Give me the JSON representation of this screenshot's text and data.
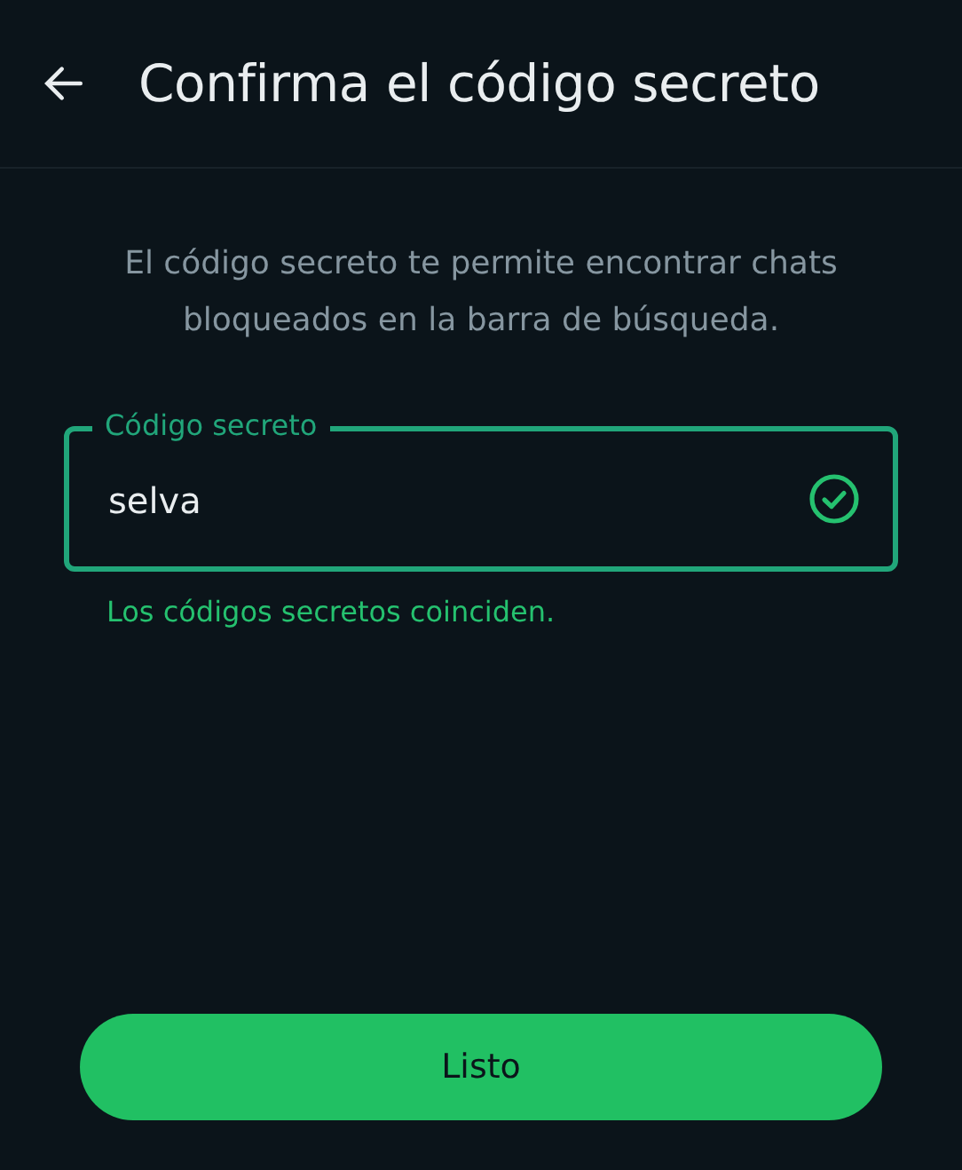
{
  "header": {
    "title": "Confirma el código secreto"
  },
  "description": "El código secreto te permite encontrar chats bloqueados en la barra de búsqueda.",
  "field": {
    "label": "Código secreto",
    "value": "selva",
    "valid": true
  },
  "helper_text": "Los códigos secretos coinciden.",
  "button": {
    "label": "Listo"
  }
}
